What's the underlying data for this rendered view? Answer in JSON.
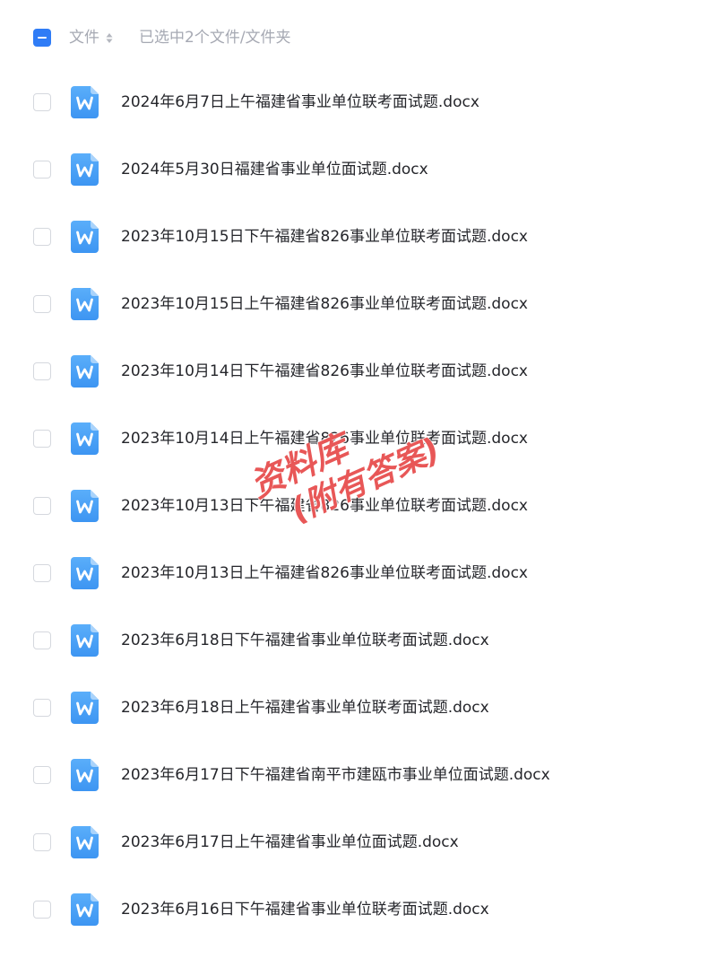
{
  "header": {
    "column_label": "文件",
    "selection_status": "已选中2个文件/文件夹"
  },
  "files": [
    {
      "name": "2024年6月7日上午福建省事业单位联考面试题.docx"
    },
    {
      "name": "2024年5月30日福建省事业单位面试题.docx"
    },
    {
      "name": "2023年10月15日下午福建省826事业单位联考面试题.docx"
    },
    {
      "name": "2023年10月15日上午福建省826事业单位联考面试题.docx"
    },
    {
      "name": "2023年10月14日下午福建省826事业单位联考面试题.docx"
    },
    {
      "name": "2023年10月14日上午福建省826事业单位联考面试题.docx"
    },
    {
      "name": "2023年10月13日下午福建省826事业单位联考面试题.docx"
    },
    {
      "name": "2023年10月13日上午福建省826事业单位联考面试题.docx"
    },
    {
      "name": "2023年6月18日下午福建省事业单位联考面试题.docx"
    },
    {
      "name": "2023年6月18日上午福建省事业单位联考面试题.docx"
    },
    {
      "name": "2023年6月17日下午福建省南平市建瓯市事业单位面试题.docx"
    },
    {
      "name": "2023年6月17日上午福建省事业单位面试题.docx"
    },
    {
      "name": "2023年6月16日下午福建省事业单位联考面试题.docx"
    }
  ],
  "icons": {
    "file_type": "word-doc-icon",
    "select_all": "indeterminate-checkbox-icon",
    "sort": "sort-icon"
  },
  "colors": {
    "accent": "#2f7cf6",
    "doc_icon": "#4da3f7",
    "watermark": "#e22828"
  },
  "watermark": {
    "line1": "资料库",
    "line2": "(附有答案)"
  }
}
